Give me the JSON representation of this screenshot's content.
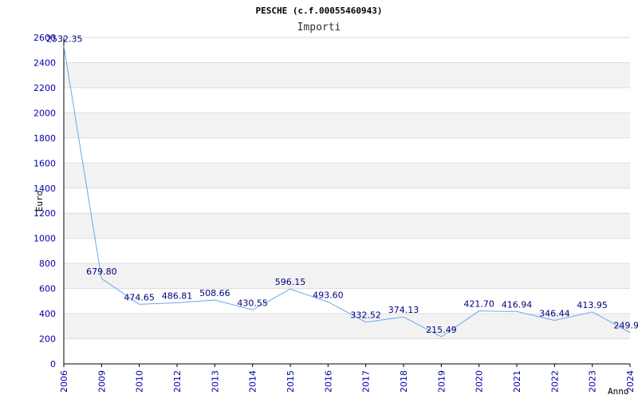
{
  "chart_data": {
    "type": "line",
    "title": "PESCHE (c.f.00055460943)",
    "subtitle": "Importi",
    "ylabel": "Euro",
    "xlabel": "Anno",
    "ylim": [
      0,
      2600
    ],
    "y_ticks": [
      0,
      200,
      400,
      600,
      800,
      1000,
      1200,
      1400,
      1600,
      1800,
      2000,
      2200,
      2400,
      2600
    ],
    "grid": "horizontal alternating bands",
    "categories": [
      "2006",
      "2009",
      "2010",
      "2012",
      "2013",
      "2014",
      "2015",
      "2016",
      "2017",
      "2018",
      "2019",
      "2020",
      "2021",
      "2022",
      "2023",
      "2024"
    ],
    "values": [
      2532.35,
      679.8,
      474.65,
      486.81,
      508.66,
      430.55,
      596.15,
      493.6,
      332.52,
      374.13,
      215.49,
      421.7,
      416.94,
      346.44,
      413.95,
      249.9
    ],
    "value_labels": [
      "2532.35",
      "679.80",
      "474.65",
      "486.81",
      "508.66",
      "430.55",
      "596.15",
      "493.60",
      "332.52",
      "374.13",
      "215.49",
      "421.70",
      "416.94",
      "346.44",
      "413.95",
      "249.9"
    ],
    "colors": {
      "line": "#66aaee",
      "band": "#f2f2f2",
      "gridline": "#dddddd",
      "tick_text": "#0000aa",
      "label_text": "#000080"
    }
  }
}
